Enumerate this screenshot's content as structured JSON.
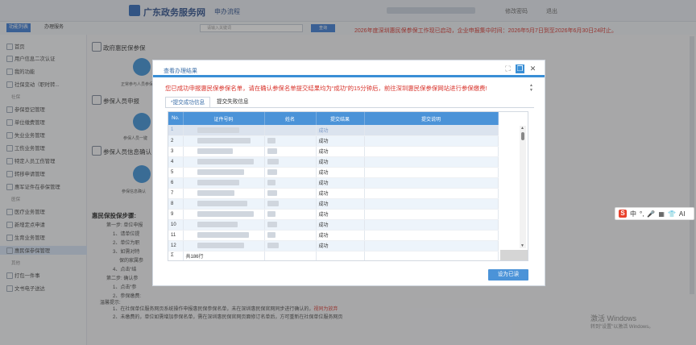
{
  "header": {
    "site_title": "广东政务服务网",
    "process_link": "申办流程",
    "change_password": "修改密码",
    "logout": "退出"
  },
  "subbar": {
    "tab_active": "功能列表",
    "tab_other": "办理服务",
    "search_placeholder": "请输入关键词",
    "search_button": "查询",
    "notice": "2026年度深圳惠民保参保工作现已启动，企业申报集中时间：2026年5月7日到至2026年6月30日24时止。"
  },
  "sidebar": {
    "items": [
      "首页",
      "用户信息二次认证",
      "我的功能",
      "社保变动（职时转...",
      "参保登记管理",
      "单位缴费管理",
      "失业业务管理",
      "工伤业务管理",
      "特定人员工伤管理",
      "转移申请管理",
      "惠军证件在参保管理",
      "医疗业务管理",
      "新增定点申请",
      "生育业务管理",
      "惠民保参保管理",
      "打包一件事",
      "文书电子送达"
    ],
    "groups": [
      "社保",
      "医保",
      "其他"
    ]
  },
  "content": {
    "section1_title": "政府惠民保参保",
    "section1_caption": "正常参与人员参保",
    "section2_title": "参保人员申报",
    "section2_caption": "参保人员一键",
    "section3_title": "参保人员信息确认",
    "section3_caption": "参保信息确认",
    "steps_title": "惠民保投保步骤:",
    "steps": [
      "第一步: 单位申报",
      "1、请单位提",
      "2、单位为职",
      "3、如需对特",
      "保的家属参",
      "4、点击“结",
      "第二步: 确认参",
      "1、点击“参",
      "2、参保缴费:",
      "温馨提示:",
      "1、在社保单位服务网页系统操作申报惠民保参保名单，未在深圳惠民保官网同步进行确认的，",
      "2、未缴费的，单位如需增加参保名单，需在深圳惠民保官网页面修订名单后，方可重新在社保单位服务网页"
    ],
    "red_note": "视同为放弃"
  },
  "ime_toolbar": {
    "logo": "S",
    "items": [
      "中",
      "°,",
      "🎤",
      "▦",
      "👕",
      "AI"
    ]
  },
  "watermark": {
    "line1": "激活 Windows",
    "line2": "转到\"设置\"以激活 Windows。"
  },
  "modal": {
    "title": "查看办理结果",
    "success_message": "您已成功申报惠民保参保名单，请在确认参保名单提交结果均为“成功”的15分钟后，前往深圳惠民保参保网站进行参保缴费!",
    "tabs": [
      "*提交成功信息",
      "提交失败信息"
    ],
    "columns": [
      "No.",
      "证件号码",
      "姓名",
      "提交结果",
      "提交说明"
    ],
    "rows": [
      {
        "no": "1",
        "result": "成功"
      },
      {
        "no": "2",
        "result": "成功"
      },
      {
        "no": "3",
        "result": "成功"
      },
      {
        "no": "4",
        "result": "成功"
      },
      {
        "no": "5",
        "result": "成功"
      },
      {
        "no": "6",
        "result": "成功"
      },
      {
        "no": "7",
        "result": "成功"
      },
      {
        "no": "8",
        "result": "成功"
      },
      {
        "no": "9",
        "result": "成功"
      },
      {
        "no": "10",
        "result": "成功"
      },
      {
        "no": "11",
        "result": "成功"
      },
      {
        "no": "12",
        "result": "成功"
      }
    ],
    "summary_symbol": "Σ",
    "summary_text": "共186行",
    "confirm_button": "设为已读"
  }
}
